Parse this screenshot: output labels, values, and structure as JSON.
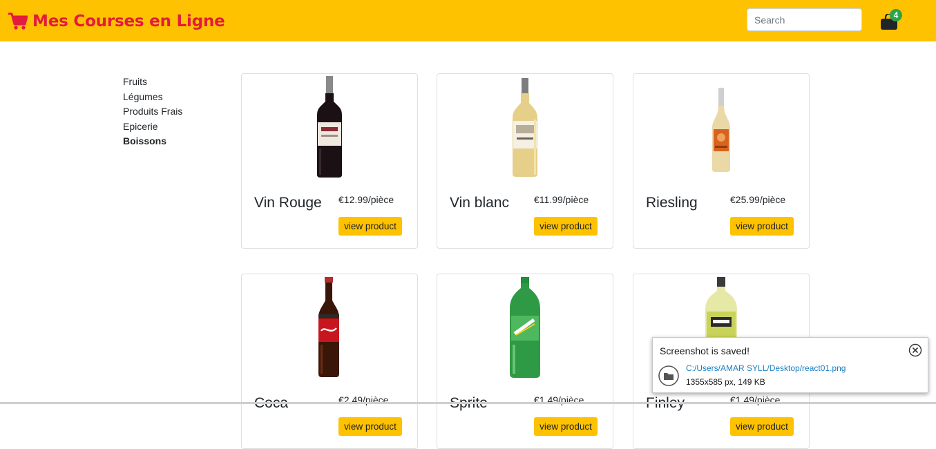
{
  "header": {
    "brand": "Mes Courses en Ligne",
    "brand_icon": "shopping-cart-icon",
    "search_placeholder": "Search",
    "cart_icon": "shopping-bag-icon",
    "cart_count": "4"
  },
  "colors": {
    "navbar": "#fec200",
    "brand": "#e31b3c",
    "badge": "#2ca44a",
    "button": "#fec200",
    "link": "#1a7fc4"
  },
  "sidebar": {
    "categories": [
      {
        "label": "Fruits",
        "active": false
      },
      {
        "label": "Légumes",
        "active": false
      },
      {
        "label": "Produits Frais",
        "active": false
      },
      {
        "label": "Epicerie",
        "active": false
      },
      {
        "label": "Boissons",
        "active": true
      }
    ]
  },
  "products": [
    {
      "name": "Vin Rouge",
      "price": "€12.99/pièce",
      "button": "view product",
      "image": "red-wine-bottle"
    },
    {
      "name": "Vin blanc",
      "price": "€11.99/pièce",
      "button": "view product",
      "image": "white-wine-bottle"
    },
    {
      "name": "Riesling",
      "price": "€25.99/pièce",
      "button": "view product",
      "image": "riesling-bottle"
    },
    {
      "name": "Coca",
      "price": "€2.49/pièce",
      "button": "view product",
      "image": "coca-cola-bottle"
    },
    {
      "name": "Sprite",
      "price": "€1.49/pièce",
      "button": "view product",
      "image": "sprite-bottle"
    },
    {
      "name": "Finley",
      "price": "€1.49/pièce",
      "button": "view product",
      "image": "finley-bottle"
    }
  ],
  "toast": {
    "title": "Screenshot is saved!",
    "path": "C:/Users/AMAR SYLL/Desktop/react01.png",
    "info": "1355x585 px, 149 KB",
    "close_icon": "close-circle-icon",
    "folder_icon": "folder-icon"
  }
}
